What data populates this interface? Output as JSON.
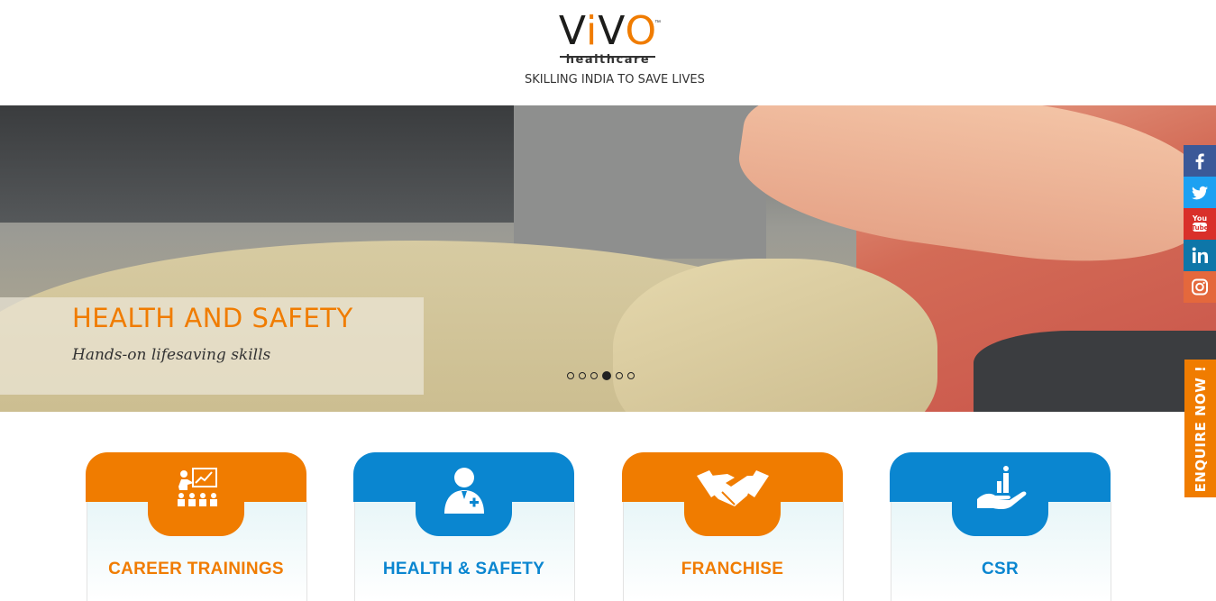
{
  "brand": {
    "logo_word": "VIVO",
    "logo_sub": "healthcare",
    "tagline": "SKILLING INDIA TO SAVE LIVES",
    "trademark": "™"
  },
  "hero": {
    "title": "HEALTH AND SAFETY",
    "subtitle": "Hands-on lifesaving skills",
    "slides_total": 6,
    "active_slide": 4
  },
  "social": [
    {
      "name": "facebook",
      "glyph": "f",
      "color": "#3b5998"
    },
    {
      "name": "twitter",
      "glyph": "t",
      "color": "#1da1f2"
    },
    {
      "name": "youtube",
      "glyph": "▶",
      "color": "#d9302a"
    },
    {
      "name": "linkedin",
      "glyph": "in",
      "color": "#0e76a8"
    },
    {
      "name": "instagram",
      "glyph": "◎",
      "color": "#e4683c"
    }
  ],
  "enquire_label": "ENQUIRE NOW !",
  "cards": [
    {
      "label": "CAREER TRAININGS",
      "icon": "classroom-icon",
      "color": "#f07c00"
    },
    {
      "label": "HEALTH & SAFETY",
      "icon": "doctor-icon",
      "color": "#0a86d0"
    },
    {
      "label": "FRANCHISE",
      "icon": "handshake-icon",
      "color": "#f07c00"
    },
    {
      "label": "CSR",
      "icon": "helping-hand-icon",
      "color": "#0a86d0"
    }
  ]
}
